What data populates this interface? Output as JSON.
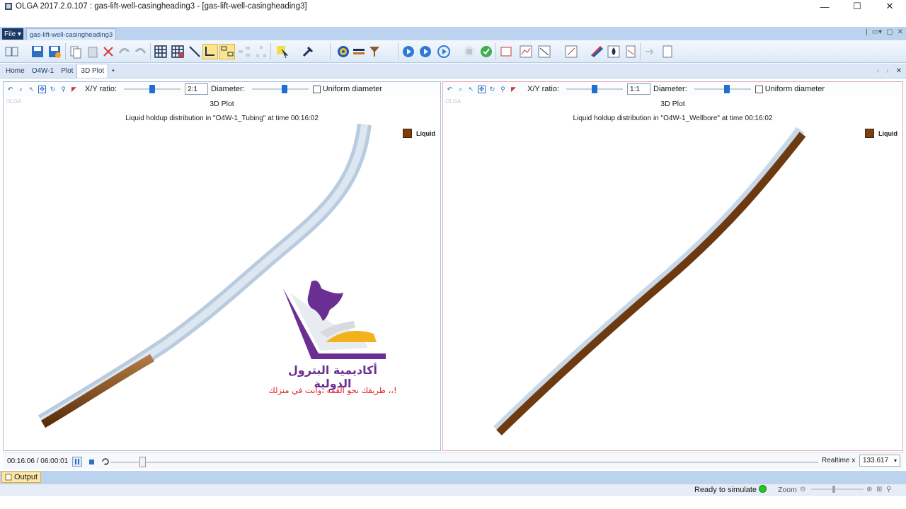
{
  "window": {
    "title": "OLGA 2017.2.0.107 : gas-lift-well-casingheading3 - [gas-lift-well-casingheading3]",
    "minimize": "—",
    "maximize": "☐",
    "close": "✕"
  },
  "file_menu": {
    "label": "File ▾"
  },
  "document_tab": {
    "label": "gas-lift-well-casingheading3"
  },
  "nav_tabs": [
    {
      "label": "Home",
      "active": false
    },
    {
      "label": "O4W-1",
      "active": false
    },
    {
      "label": "Plot",
      "active": false
    },
    {
      "label": "3D Plot",
      "active": true
    },
    {
      "label": "•",
      "active": false
    }
  ],
  "left_plot": {
    "xy_label": "X/Y ratio:",
    "xy_value": "2:1",
    "diameter_label": "Diameter:",
    "uniform_label": "Uniform diameter",
    "watermark": "OLGA",
    "heading": "3D Plot",
    "subtitle": "Liquid holdup distribution in \"O4W-1_Tubing\" at time 00:16:02",
    "legend": "Liquid"
  },
  "right_plot": {
    "xy_label": "X/Y ratio:",
    "xy_value": "1:1",
    "diameter_label": "Diameter:",
    "uniform_label": "Uniform diameter",
    "watermark": "OLGA",
    "heading": "3D Plot",
    "subtitle": "Liquid holdup distribution in \"O4W-1_Wellbore\" at time 00:16:02",
    "legend": "Liquid"
  },
  "overlay": {
    "line1": "أكاديمية البترول الدولية",
    "line2": "طريقك نحو القمة ،وأنت في منزلك ،،!"
  },
  "timeline": {
    "time": "00:16:06 / 06:00:01",
    "realtime_label": "Realtime x",
    "realtime_value": "133.617"
  },
  "output_tab": {
    "label": "Output"
  },
  "status": {
    "text": "Ready to simulate",
    "zoom_label": "Zoom",
    "indicator_color": "#28c428"
  },
  "colors": {
    "liquid": "#7a3f10",
    "pipe": "#c9d8e8",
    "accent": "#1f6fd0"
  }
}
